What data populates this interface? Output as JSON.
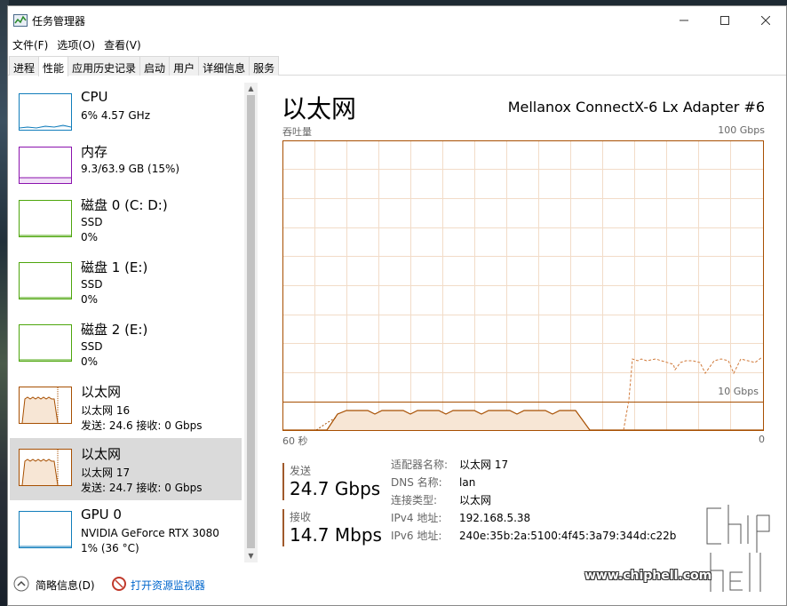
{
  "window": {
    "title": "任务管理器"
  },
  "menu": [
    "文件(F)",
    "选项(O)",
    "查看(V)"
  ],
  "tabs": [
    {
      "label": "进程",
      "active": false
    },
    {
      "label": "性能",
      "active": true
    },
    {
      "label": "应用历史记录",
      "active": false
    },
    {
      "label": "启动",
      "active": false
    },
    {
      "label": "用户",
      "active": false
    },
    {
      "label": "详细信息",
      "active": false
    },
    {
      "label": "服务",
      "active": false
    }
  ],
  "sidebar": {
    "items": [
      {
        "title": "CPU",
        "line1": "6% 4.57 GHz",
        "line2": "",
        "color": "#117dbb"
      },
      {
        "title": "内存",
        "line1": "9.3/63.9 GB (15%)",
        "line2": "",
        "color": "#8b12ae"
      },
      {
        "title": "磁盘 0 (C: D:)",
        "line1": "SSD",
        "line2": "0%",
        "color": "#4da60c"
      },
      {
        "title": "磁盘 1 (E:)",
        "line1": "SSD",
        "line2": "0%",
        "color": "#4da60c"
      },
      {
        "title": "磁盘 2 (E:)",
        "line1": "SSD",
        "line2": "0%",
        "color": "#4da60c"
      },
      {
        "title": "以太网",
        "line1": "以太网 16",
        "line2": "发送: 24.6  接收: 0 Gbps",
        "color": "#a74f01"
      },
      {
        "title": "以太网",
        "line1": "以太网 17",
        "line2": "发送: 24.7  接收: 0 Gbps",
        "color": "#a74f01",
        "selected": true
      },
      {
        "title": "GPU 0",
        "line1": "NVIDIA GeForce RTX 3080",
        "line2": "1% (36 °C)",
        "color": "#117dbb"
      }
    ]
  },
  "main": {
    "title": "以太网",
    "device": "Mellanox ConnectX-6 Lx Adapter #6",
    "throughput_label": "吞吐量",
    "max_label": "100 Gbps",
    "scale_label": "10 Gbps",
    "axis_left": "60 秒",
    "axis_right": "0",
    "send_label": "发送",
    "send_value": "24.7 Gbps",
    "recv_label": "接收",
    "recv_value": "14.7 Mbps",
    "info": [
      {
        "key": "适配器名称:",
        "value": "以太网 17"
      },
      {
        "key": "DNS 名称:",
        "value": "lan"
      },
      {
        "key": "连接类型:",
        "value": "以太网"
      },
      {
        "key": "IPv4 地址:",
        "value": "192.168.5.38"
      },
      {
        "key": "IPv6 地址:",
        "value": "240e:35b:2a:5100:4f45:3a79:344d:c22b"
      }
    ]
  },
  "footer": {
    "summary_label": "简略信息(D)",
    "monitor_label": "打开资源监视器"
  },
  "watermark": {
    "url": "www.chiphell.com"
  }
}
